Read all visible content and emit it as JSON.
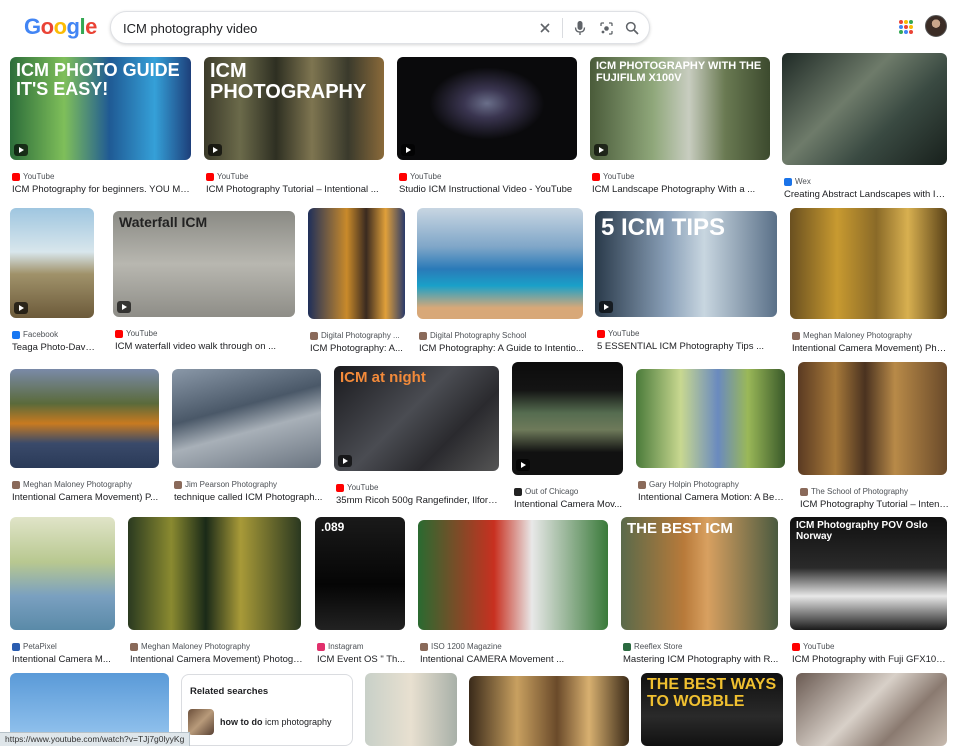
{
  "header": {
    "logo": "Google",
    "logo_colors": [
      "#4285F4",
      "#EA4335",
      "#FBBC05",
      "#4285F4",
      "#34A853",
      "#EA4335"
    ],
    "search_query": "ICM photography video",
    "icons": [
      "clear-icon",
      "microphone-icon",
      "lens-icon",
      "search-icon"
    ]
  },
  "results": [
    {
      "source": "YouTube",
      "title": "ICM Photography for beginners. YOU MU...",
      "overlay": "ICM PHOTO GUIDE IT'S EASY!"
    },
    {
      "source": "YouTube",
      "title": "ICM Photography Tutorial – Intentional ...",
      "overlay": "ICM PHOTOGRAPHY"
    },
    {
      "source": "YouTube",
      "title": "Studio ICM Instructional Video - YouTube",
      "overlay": ""
    },
    {
      "source": "YouTube",
      "title": "ICM Landscape Photography With a ...",
      "overlay": "ICM PHOTOGRAPHY WITH THE FUJIFILM X100V"
    },
    {
      "source": "Wex",
      "title": "Creating Abstract Landscapes with IC...",
      "overlay": ""
    },
    {
      "source": "Facebook",
      "title": "Teaga Photo-David...",
      "overlay": ""
    },
    {
      "source": "YouTube",
      "title": "ICM waterfall video walk through on ...",
      "overlay": "Waterfall ICM"
    },
    {
      "source": "Digital Photography ...",
      "title": "ICM Photography: A...",
      "overlay": ""
    },
    {
      "source": "Digital Photography School",
      "title": "ICM Photography: A Guide to Intentio...",
      "overlay": ""
    },
    {
      "source": "YouTube",
      "title": "5 ESSENTIAL ICM Photography Tips ...",
      "overlay": "5 ICM TIPS"
    },
    {
      "source": "Meghan Maloney Photography",
      "title": "Intentional Camera Movement) Pho...",
      "overlay": ""
    },
    {
      "source": "Meghan Maloney Photography",
      "title": "Intentional Camera Movement) P...",
      "overlay": ""
    },
    {
      "source": "Jim Pearson Photography",
      "title": "technique called ICM Photograph...",
      "overlay": ""
    },
    {
      "source": "YouTube",
      "title": "35mm Ricoh 500g Rangefinder, Ilford...",
      "overlay": "ICM at night"
    },
    {
      "source": "Out of Chicago",
      "title": "Intentional Camera Mov...",
      "overlay": ""
    },
    {
      "source": "Gary Holpin Photography",
      "title": "Intentional Camera Motion: A Beg...",
      "overlay": ""
    },
    {
      "source": "The School of Photography",
      "title": "ICM Photography Tutorial – Intent...",
      "overlay": ""
    },
    {
      "source": "PetaPixel",
      "title": "Intentional Camera M...",
      "overlay": ""
    },
    {
      "source": "Meghan Maloney Photography",
      "title": "Intentional Camera Movement) Photogr...",
      "overlay": ""
    },
    {
      "source": "Instagram",
      "title": "ICM Event OS \" Th...",
      "overlay": ".089"
    },
    {
      "source": "ISO 1200 Magazine",
      "title": "Intentional CAMERA Movement ...",
      "overlay": ""
    },
    {
      "source": "Reeflex Store",
      "title": "Mastering ICM Photography with R...",
      "overlay": "THE BEST ICM"
    },
    {
      "source": "YouTube",
      "title": "ICM Photography with Fuji GFX100...",
      "overlay": "ICM Photography POV Oslo Norway"
    },
    {
      "source": "",
      "title": "",
      "overlay": ""
    },
    {
      "source": "",
      "title": "",
      "overlay": ""
    },
    {
      "source": "",
      "title": "",
      "overlay": ""
    },
    {
      "source": "",
      "title": "",
      "overlay": "THE BEST WAYS TO WOBBLE"
    },
    {
      "source": "",
      "title": "",
      "overlay": ""
    }
  ],
  "related": {
    "heading": "Related searches",
    "items": [
      {
        "bold": "how to do",
        "rest": " icm photography"
      }
    ]
  },
  "status_url": "https://www.youtube.com/watch?v=TJj7g0lyyKg"
}
